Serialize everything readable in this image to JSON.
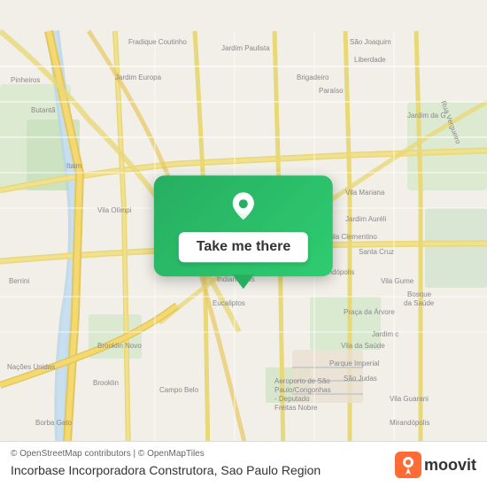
{
  "map": {
    "attribution": "© OpenStreetMap contributors | © OpenMapTiles",
    "location_name": "Incorbase Incorporadora Construtora, Sao Paulo Region",
    "background_color": "#f2efe9"
  },
  "card": {
    "button_label": "Take me there",
    "pin_icon": "location-pin"
  },
  "moovit": {
    "logo_text": "moovit"
  },
  "roads": {
    "accent_color": "#e8e0c8",
    "major_road_color": "#f5d67a",
    "minor_road_color": "#ffffff",
    "green_area": "#c8dfc8",
    "water_color": "#a8d4e6"
  }
}
